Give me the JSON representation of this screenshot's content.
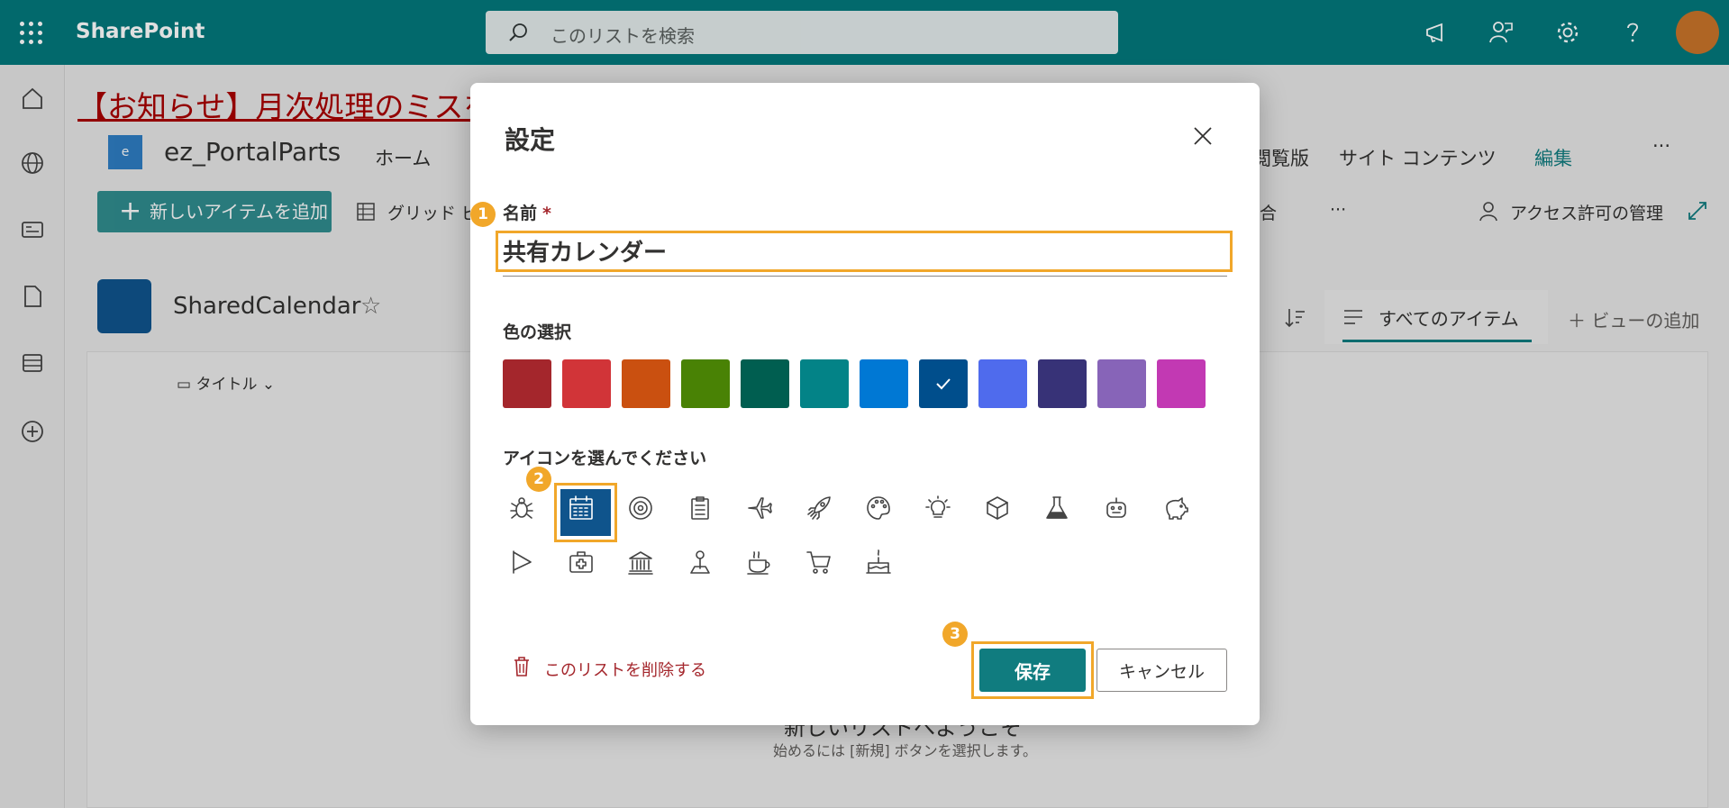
{
  "suite": {
    "brand": "SharePoint",
    "search_placeholder": "このリストを検索"
  },
  "notice": "【お知らせ】月次処理のミスを減",
  "site": {
    "logo_letter": "e",
    "name": "ez_PortalParts",
    "nav": [
      "ホーム",
      "閲覧版",
      "サイト コンテンツ",
      "編集"
    ],
    "more": "···"
  },
  "commandbar": {
    "new_item": "新しいアイテムを追加",
    "grid_view": "グリッド ビュ",
    "integrate": "合",
    "more": "···",
    "manage_access": "アクセス許可の管理"
  },
  "list": {
    "title": "SharedCalendar",
    "view": "すべてのアイテム",
    "add_view": "ビューの追加",
    "column_title": "タイトル",
    "welcome": "新しいリストへようこそ",
    "hint": "始めるには [新規] ボタンを選択します。"
  },
  "dialog": {
    "title": "設定",
    "name_label": "名前",
    "required_mark": "*",
    "name_value": "共有カレンダー",
    "color_label": "色の選択",
    "colors": [
      "#a4262c",
      "#d13438",
      "#ca5010",
      "#498205",
      "#005e50",
      "#038387",
      "#0078d4",
      "#004e8c",
      "#4f6bed",
      "#373277",
      "#8764b8",
      "#c239b3"
    ],
    "selected_color": "#004e8c",
    "icon_label": "アイコンを選んでください",
    "icons": [
      "bug-icon",
      "calendar-icon",
      "target-icon",
      "clipboard-icon",
      "airplane-icon",
      "rocket-icon",
      "palette-icon",
      "lightbulb-icon",
      "cube-icon",
      "flask-icon",
      "robot-icon",
      "piggybank-icon",
      "flag-icon",
      "medical-kit-icon",
      "bank-icon",
      "map-pin-icon",
      "coffee-icon",
      "cart-icon",
      "cake-icon"
    ],
    "selected_icon": "calendar-icon",
    "delete_label": "このリストを削除する",
    "save_label": "保存",
    "cancel_label": "キャンセル"
  },
  "badges": [
    "1",
    "2",
    "3"
  ]
}
